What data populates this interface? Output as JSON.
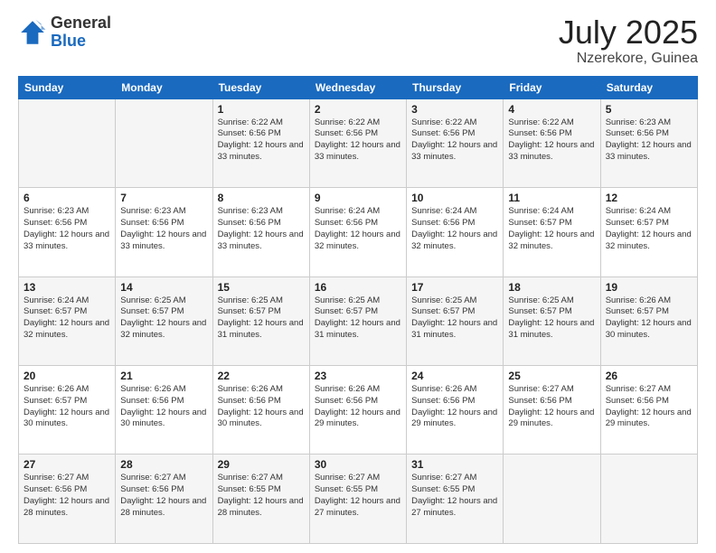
{
  "logo": {
    "general": "General",
    "blue": "Blue"
  },
  "header": {
    "title": "July 2025",
    "subtitle": "Nzerekore, Guinea"
  },
  "days_of_week": [
    "Sunday",
    "Monday",
    "Tuesday",
    "Wednesday",
    "Thursday",
    "Friday",
    "Saturday"
  ],
  "weeks": [
    [
      {
        "day": "",
        "info": ""
      },
      {
        "day": "",
        "info": ""
      },
      {
        "day": "1",
        "info": "Sunrise: 6:22 AM\nSunset: 6:56 PM\nDaylight: 12 hours and 33 minutes."
      },
      {
        "day": "2",
        "info": "Sunrise: 6:22 AM\nSunset: 6:56 PM\nDaylight: 12 hours and 33 minutes."
      },
      {
        "day": "3",
        "info": "Sunrise: 6:22 AM\nSunset: 6:56 PM\nDaylight: 12 hours and 33 minutes."
      },
      {
        "day": "4",
        "info": "Sunrise: 6:22 AM\nSunset: 6:56 PM\nDaylight: 12 hours and 33 minutes."
      },
      {
        "day": "5",
        "info": "Sunrise: 6:23 AM\nSunset: 6:56 PM\nDaylight: 12 hours and 33 minutes."
      }
    ],
    [
      {
        "day": "6",
        "info": "Sunrise: 6:23 AM\nSunset: 6:56 PM\nDaylight: 12 hours and 33 minutes."
      },
      {
        "day": "7",
        "info": "Sunrise: 6:23 AM\nSunset: 6:56 PM\nDaylight: 12 hours and 33 minutes."
      },
      {
        "day": "8",
        "info": "Sunrise: 6:23 AM\nSunset: 6:56 PM\nDaylight: 12 hours and 33 minutes."
      },
      {
        "day": "9",
        "info": "Sunrise: 6:24 AM\nSunset: 6:56 PM\nDaylight: 12 hours and 32 minutes."
      },
      {
        "day": "10",
        "info": "Sunrise: 6:24 AM\nSunset: 6:56 PM\nDaylight: 12 hours and 32 minutes."
      },
      {
        "day": "11",
        "info": "Sunrise: 6:24 AM\nSunset: 6:57 PM\nDaylight: 12 hours and 32 minutes."
      },
      {
        "day": "12",
        "info": "Sunrise: 6:24 AM\nSunset: 6:57 PM\nDaylight: 12 hours and 32 minutes."
      }
    ],
    [
      {
        "day": "13",
        "info": "Sunrise: 6:24 AM\nSunset: 6:57 PM\nDaylight: 12 hours and 32 minutes."
      },
      {
        "day": "14",
        "info": "Sunrise: 6:25 AM\nSunset: 6:57 PM\nDaylight: 12 hours and 32 minutes."
      },
      {
        "day": "15",
        "info": "Sunrise: 6:25 AM\nSunset: 6:57 PM\nDaylight: 12 hours and 31 minutes."
      },
      {
        "day": "16",
        "info": "Sunrise: 6:25 AM\nSunset: 6:57 PM\nDaylight: 12 hours and 31 minutes."
      },
      {
        "day": "17",
        "info": "Sunrise: 6:25 AM\nSunset: 6:57 PM\nDaylight: 12 hours and 31 minutes."
      },
      {
        "day": "18",
        "info": "Sunrise: 6:25 AM\nSunset: 6:57 PM\nDaylight: 12 hours and 31 minutes."
      },
      {
        "day": "19",
        "info": "Sunrise: 6:26 AM\nSunset: 6:57 PM\nDaylight: 12 hours and 30 minutes."
      }
    ],
    [
      {
        "day": "20",
        "info": "Sunrise: 6:26 AM\nSunset: 6:57 PM\nDaylight: 12 hours and 30 minutes."
      },
      {
        "day": "21",
        "info": "Sunrise: 6:26 AM\nSunset: 6:56 PM\nDaylight: 12 hours and 30 minutes."
      },
      {
        "day": "22",
        "info": "Sunrise: 6:26 AM\nSunset: 6:56 PM\nDaylight: 12 hours and 30 minutes."
      },
      {
        "day": "23",
        "info": "Sunrise: 6:26 AM\nSunset: 6:56 PM\nDaylight: 12 hours and 29 minutes."
      },
      {
        "day": "24",
        "info": "Sunrise: 6:26 AM\nSunset: 6:56 PM\nDaylight: 12 hours and 29 minutes."
      },
      {
        "day": "25",
        "info": "Sunrise: 6:27 AM\nSunset: 6:56 PM\nDaylight: 12 hours and 29 minutes."
      },
      {
        "day": "26",
        "info": "Sunrise: 6:27 AM\nSunset: 6:56 PM\nDaylight: 12 hours and 29 minutes."
      }
    ],
    [
      {
        "day": "27",
        "info": "Sunrise: 6:27 AM\nSunset: 6:56 PM\nDaylight: 12 hours and 28 minutes."
      },
      {
        "day": "28",
        "info": "Sunrise: 6:27 AM\nSunset: 6:56 PM\nDaylight: 12 hours and 28 minutes."
      },
      {
        "day": "29",
        "info": "Sunrise: 6:27 AM\nSunset: 6:55 PM\nDaylight: 12 hours and 28 minutes."
      },
      {
        "day": "30",
        "info": "Sunrise: 6:27 AM\nSunset: 6:55 PM\nDaylight: 12 hours and 27 minutes."
      },
      {
        "day": "31",
        "info": "Sunrise: 6:27 AM\nSunset: 6:55 PM\nDaylight: 12 hours and 27 minutes."
      },
      {
        "day": "",
        "info": ""
      },
      {
        "day": "",
        "info": ""
      }
    ]
  ]
}
